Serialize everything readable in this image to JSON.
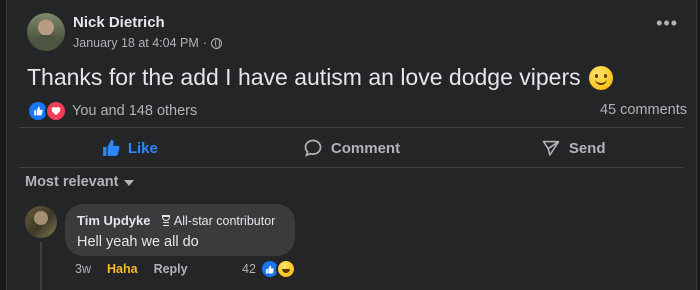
{
  "post": {
    "author": "Nick Dietrich",
    "timestamp": "January 18 at 4:04 PM",
    "separator": "·",
    "privacy_icon": "globe-icon",
    "more_label": "•••",
    "text": "Thanks for the add I have autism an love dodge vipers",
    "emoji": "slightly-smiling-face-icon",
    "reactions_text": "You and 148 others",
    "reaction_icons": [
      "like-icon",
      "love-icon"
    ],
    "comments_count": "45 comments"
  },
  "actions": {
    "like": "Like",
    "comment": "Comment",
    "send": "Send"
  },
  "sort": {
    "label": "Most relevant"
  },
  "comment": {
    "author": "Tim Updyke",
    "badge": "All-star contributor",
    "text": "Hell yeah we all do",
    "time": "3w",
    "reaction_label": "Haha",
    "reply_label": "Reply",
    "reaction_count": "42",
    "reaction_icons": [
      "like-icon",
      "laugh-icon"
    ]
  },
  "colors": {
    "background": "#242526",
    "page": "#18191a",
    "text_primary": "#e4e6eb",
    "text_secondary": "#b0b3b8",
    "like_blue": "#2d88ff",
    "haha_yellow": "#f7b928",
    "bubble": "#3a3b3c"
  }
}
